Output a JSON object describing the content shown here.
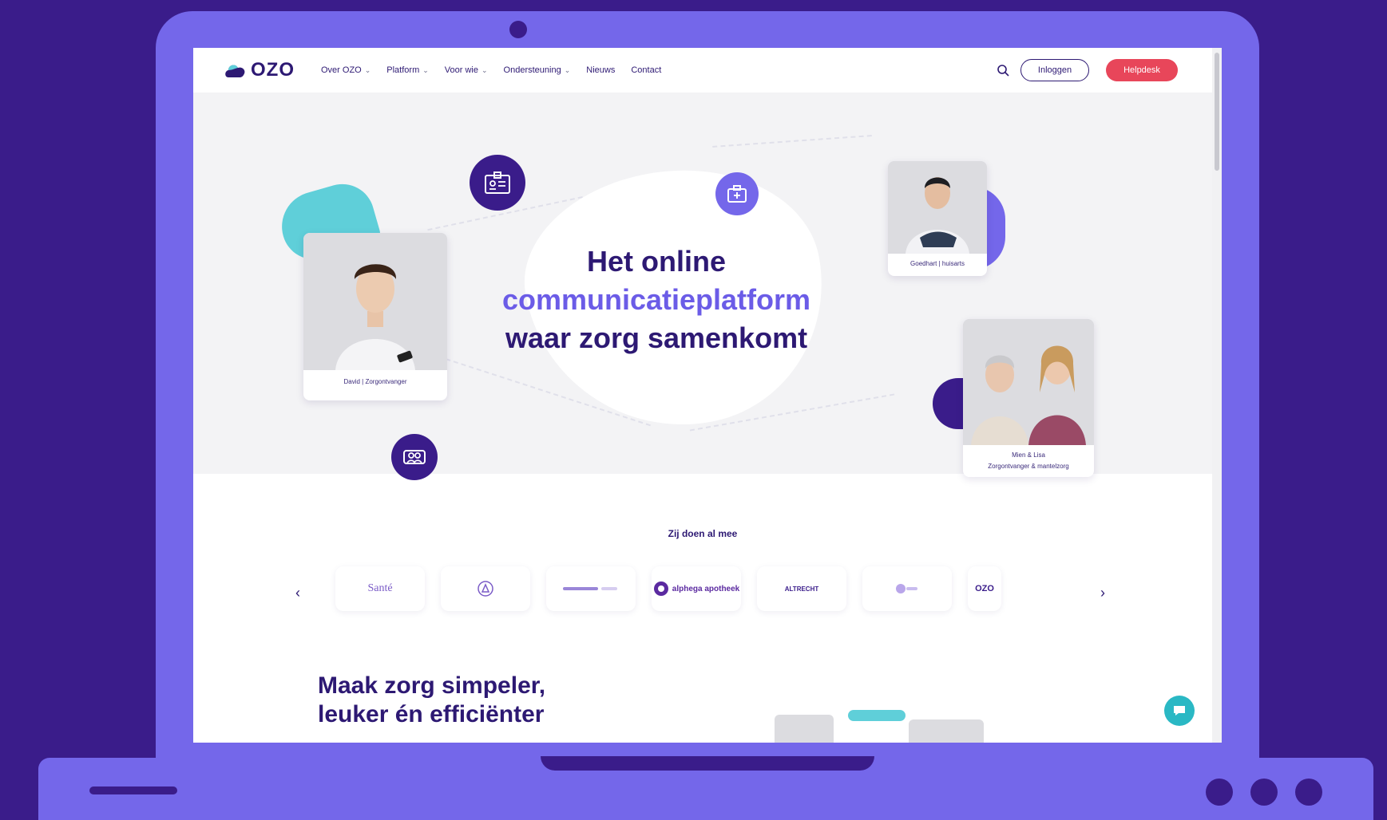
{
  "nav": {
    "logo_text": "OZO",
    "items": [
      {
        "label": "Over OZO",
        "has_dropdown": true
      },
      {
        "label": "Platform",
        "has_dropdown": true
      },
      {
        "label": "Voor wie",
        "has_dropdown": true
      },
      {
        "label": "Ondersteuning",
        "has_dropdown": true
      },
      {
        "label": "Nieuws",
        "has_dropdown": false
      },
      {
        "label": "Contact",
        "has_dropdown": false
      }
    ],
    "login_label": "Inloggen",
    "helpdesk_label": "Helpdesk",
    "search_icon": "search-icon"
  },
  "hero": {
    "line1": "Het online",
    "line2": "communicatieplatform",
    "line3": "waar zorg samenkomt",
    "cards": [
      {
        "caption": "David | Zorgontvanger"
      },
      {
        "caption": "Goedhart | huisarts"
      },
      {
        "caption_1": "Mien & Lisa",
        "caption_2": "Zorgontvanger & mantelzorg"
      }
    ],
    "icons": [
      "id-card-icon",
      "medical-bag-icon",
      "people-icon"
    ]
  },
  "partners": {
    "heading": "Zij doen al mee",
    "logos": [
      "Santé",
      "",
      "",
      "alphega apotheek",
      "ALTRECHT",
      "",
      "OZO"
    ]
  },
  "section2": {
    "title_line1": "Maak zorg simpeler,",
    "title_line2": "leuker én efficiënter"
  },
  "colors": {
    "frame": "#7467ea",
    "background": "#3a1c8a",
    "brand_dark": "#2d1973",
    "accent": "#6b5ce7",
    "helpdesk": "#e8465a",
    "teal": "#5fcfd9"
  }
}
